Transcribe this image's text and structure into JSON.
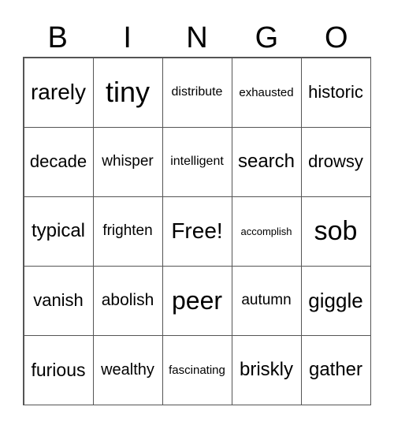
{
  "header": [
    "B",
    "I",
    "N",
    "G",
    "O"
  ],
  "cells": [
    "rarely",
    "tiny",
    "distribute",
    "exhausted",
    "historic",
    "decade",
    "whisper",
    "intelligent",
    "search",
    "drowsy",
    "typical",
    "frighten",
    "Free!",
    "accomplish",
    "sob",
    "vanish",
    "abolish",
    "peer",
    "autumn",
    "giggle",
    "furious",
    "wealthy",
    "fascinating",
    "briskly",
    "gather"
  ]
}
